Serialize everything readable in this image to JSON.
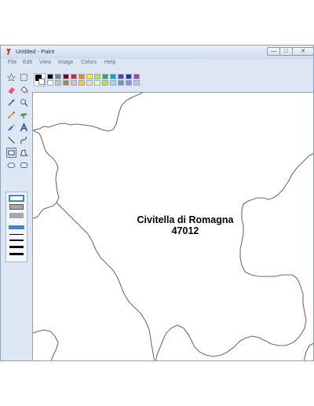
{
  "window": {
    "title": "Untitled - Paint",
    "controls": {
      "minimize": "—",
      "maximize": "□",
      "close": "✕"
    }
  },
  "menu": [
    "File",
    "Edit",
    "View",
    "Image",
    "Colors",
    "Help"
  ],
  "tools": [
    {
      "name": "free-form-select",
      "icon": "star-select-icon"
    },
    {
      "name": "select",
      "icon": "rect-select-icon"
    },
    {
      "name": "eraser",
      "icon": "eraser-icon"
    },
    {
      "name": "fill",
      "icon": "paint-bucket-icon"
    },
    {
      "name": "pick-color",
      "icon": "eyedropper-icon"
    },
    {
      "name": "magnifier",
      "icon": "magnifier-icon"
    },
    {
      "name": "pencil",
      "icon": "pencil-icon"
    },
    {
      "name": "brush",
      "icon": "brush-icon"
    },
    {
      "name": "airbrush",
      "icon": "airbrush-icon"
    },
    {
      "name": "text",
      "icon": "text-icon"
    },
    {
      "name": "line",
      "icon": "line-icon"
    },
    {
      "name": "curve",
      "icon": "curve-icon"
    },
    {
      "name": "rectangle",
      "icon": "rectangle-icon"
    },
    {
      "name": "polygon",
      "icon": "polygon-icon"
    },
    {
      "name": "ellipse",
      "icon": "ellipse-icon"
    },
    {
      "name": "rounded-rectangle",
      "icon": "rounded-rect-icon"
    }
  ],
  "selected_tool": "rectangle",
  "palette": {
    "foreground": "#000000",
    "background": "#ffffff",
    "row1": [
      "#000000",
      "#7f7f7f",
      "#880015",
      "#ed1c24",
      "#ff7f27",
      "#fff200",
      "#c8e60a",
      "#22b14c",
      "#00a2e8",
      "#3f48cc",
      "#2f3699",
      "#a349a4"
    ],
    "row2": [
      "#ffffff",
      "#c3c3c3",
      "#b97a57",
      "#ffaec9",
      "#ffc90e",
      "#efe4b0",
      "#e6ffa0",
      "#b5e61d",
      "#99d9ea",
      "#7092be",
      "#8a8fd6",
      "#c8bfe7"
    ]
  },
  "canvas": {
    "label_line1": "Civitella di Romagna",
    "label_line2": "47012"
  }
}
